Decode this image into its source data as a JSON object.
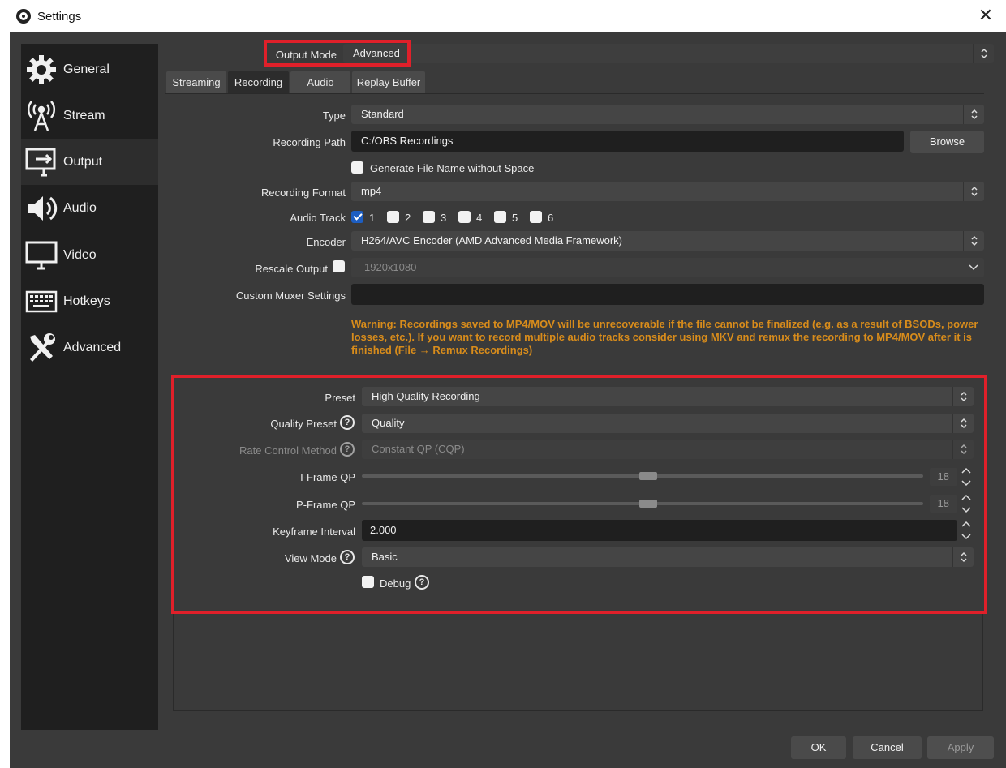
{
  "window": {
    "title": "Settings",
    "close_glyph": "✕"
  },
  "sidebar": {
    "items": [
      {
        "label": "General",
        "icon": "gear-icon"
      },
      {
        "label": "Stream",
        "icon": "broadcast-icon"
      },
      {
        "label": "Output",
        "icon": "output-monitor-icon"
      },
      {
        "label": "Audio",
        "icon": "speaker-icon"
      },
      {
        "label": "Video",
        "icon": "monitor-icon"
      },
      {
        "label": "Hotkeys",
        "icon": "keyboard-icon"
      },
      {
        "label": "Advanced",
        "icon": "tools-icon"
      }
    ],
    "active": "Output"
  },
  "output_mode": {
    "label": "Output Mode",
    "value": "Advanced"
  },
  "tabs": [
    "Streaming",
    "Recording",
    "Audio",
    "Replay Buffer"
  ],
  "active_tab": "Recording",
  "recording": {
    "type_label": "Type",
    "type_value": "Standard",
    "path_label": "Recording Path",
    "path_value": "C:/OBS Recordings",
    "browse": "Browse",
    "gen_name_label": "Generate File Name without Space",
    "format_label": "Recording Format",
    "format_value": "mp4",
    "audio_track_label": "Audio Track",
    "tracks": [
      {
        "label": "1",
        "checked": true
      },
      {
        "label": "2",
        "checked": false
      },
      {
        "label": "3",
        "checked": false
      },
      {
        "label": "4",
        "checked": false
      },
      {
        "label": "5",
        "checked": false
      },
      {
        "label": "6",
        "checked": false
      }
    ],
    "encoder_label": "Encoder",
    "encoder_value": "H264/AVC Encoder (AMD Advanced Media Framework)",
    "rescale_label": "Rescale Output",
    "rescale_value": "1920x1080",
    "muxer_label": "Custom Muxer Settings",
    "muxer_value": "",
    "warning": "Warning: Recordings saved to MP4/MOV will be unrecoverable if the file cannot be finalized (e.g. as a result of BSODs, power losses, etc.). If you want to record multiple audio tracks consider using MKV and remux the recording to MP4/MOV after it is finished (File → Remux Recordings)"
  },
  "encoder_settings": {
    "preset_label": "Preset",
    "preset_value": "High Quality Recording",
    "quality_preset_label": "Quality Preset",
    "quality_preset_value": "Quality",
    "rate_control_label": "Rate Control Method",
    "rate_control_value": "Constant QP (CQP)",
    "iframe_label": "I-Frame QP",
    "iframe_value": "18",
    "pframe_label": "P-Frame QP",
    "pframe_value": "18",
    "qp_slider_fraction": 0.51,
    "keyframe_label": "Keyframe Interval",
    "keyframe_value": "2.000",
    "view_mode_label": "View Mode",
    "view_mode_value": "Basic",
    "debug_label": "Debug",
    "help_glyph": "?"
  },
  "footer": {
    "ok": "OK",
    "cancel": "Cancel",
    "apply": "Apply"
  },
  "colors": {
    "highlight": "#e0202a",
    "warning": "#d88c1b",
    "check_accent": "#1d5ec2"
  }
}
